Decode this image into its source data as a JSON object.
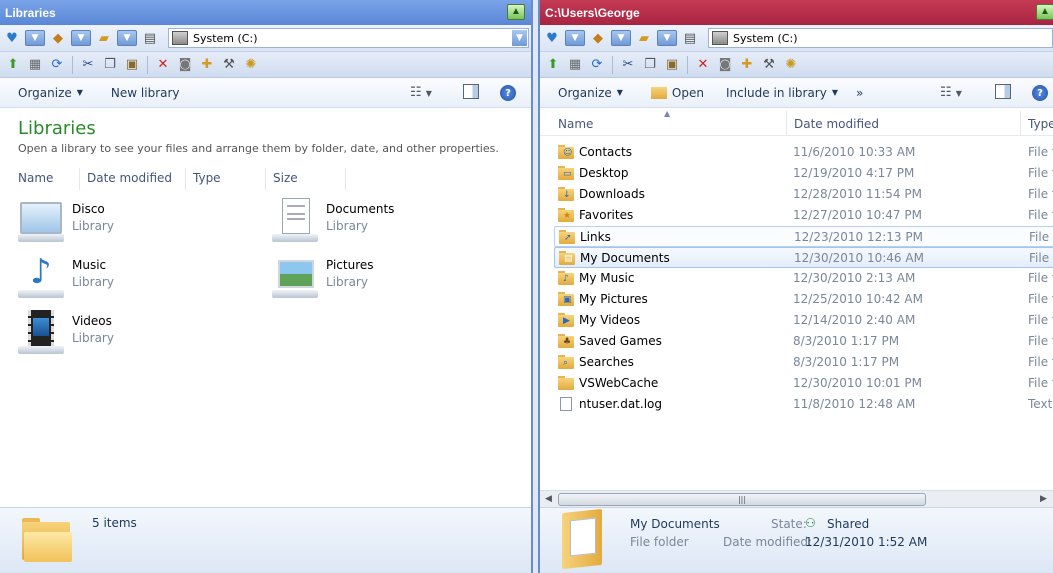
{
  "left": {
    "title": "Libraries",
    "drive": "System (C:)",
    "cmd": {
      "organize": "Organize",
      "new_library": "New library"
    },
    "heading": "Libraries",
    "subheading": "Open a library to see your files and arrange them by folder, date, and other properties.",
    "columns": [
      "Name",
      "Date modified",
      "Type",
      "Size"
    ],
    "libraries": [
      {
        "name": "Disco",
        "type": "Library",
        "icon": "monitor-library-icon"
      },
      {
        "name": "Documents",
        "type": "Library",
        "icon": "documents-library-icon"
      },
      {
        "name": "Music",
        "type": "Library",
        "icon": "music-library-icon"
      },
      {
        "name": "Pictures",
        "type": "Library",
        "icon": "pictures-library-icon"
      },
      {
        "name": "Videos",
        "type": "Library",
        "icon": "videos-library-icon"
      }
    ],
    "status": {
      "count": "5 items"
    }
  },
  "right": {
    "title": "C:\\Users\\George",
    "drive": "System (C:)",
    "cmd": {
      "organize": "Organize",
      "open": "Open",
      "include": "Include in library",
      "more": "»"
    },
    "columns": [
      "Name",
      "Date modified",
      "Type"
    ],
    "rows": [
      {
        "name": "Contacts",
        "date": "11/6/2010 10:33 AM",
        "type": "File fo"
      },
      {
        "name": "Desktop",
        "date": "12/19/2010 4:17 PM",
        "type": "File fo"
      },
      {
        "name": "Downloads",
        "date": "12/28/2010 11:54 PM",
        "type": "File fo"
      },
      {
        "name": "Favorites",
        "date": "12/27/2010 10:47 PM",
        "type": "File fo"
      },
      {
        "name": "Links",
        "date": "12/23/2010 12:13 PM",
        "type": "File fo"
      },
      {
        "name": "My Documents",
        "date": "12/30/2010 10:46 AM",
        "type": "File fo"
      },
      {
        "name": "My Music",
        "date": "12/30/2010 2:13 AM",
        "type": "File fo"
      },
      {
        "name": "My Pictures",
        "date": "12/25/2010 10:42 AM",
        "type": "File fo"
      },
      {
        "name": "My Videos",
        "date": "12/14/2010 2:40 AM",
        "type": "File fo"
      },
      {
        "name": "Saved Games",
        "date": "8/3/2010 1:17 PM",
        "type": "File fo"
      },
      {
        "name": "Searches",
        "date": "8/3/2010 1:17 PM",
        "type": "File fo"
      },
      {
        "name": "VSWebCache",
        "date": "12/30/2010 10:01 PM",
        "type": "File fo"
      },
      {
        "name": "ntuser.dat.log",
        "date": "11/8/2010 12:48 AM",
        "type": "Text"
      }
    ],
    "status": {
      "name": "My Documents",
      "kind": "File folder",
      "state_label": "State:",
      "state_value": "Shared",
      "modified_label": "Date modified:",
      "modified_value": "12/31/2010 1:52 AM"
    }
  },
  "colors": {
    "left_title": "#5a86d6",
    "right_title": "#a82441",
    "heading_green": "#2a8a2a"
  }
}
